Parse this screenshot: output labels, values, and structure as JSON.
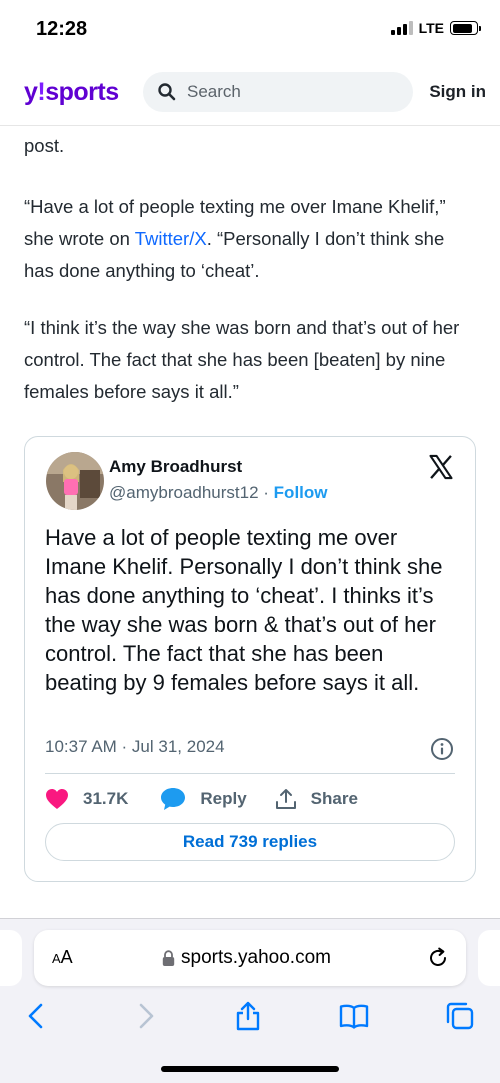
{
  "status_bar": {
    "time": "12:28",
    "network": "LTE",
    "battery_level": 0.85
  },
  "header": {
    "logo_y": "y",
    "logo_bang": "!",
    "logo_word": "sports",
    "search_placeholder": "Search",
    "signin_label": "Sign in"
  },
  "article": {
    "p0": "post.",
    "p1_a": "“Have a lot of people texting me over Imane Khelif,” she wrote on ",
    "p1_link": "Twitter/X",
    "p1_b": ". “Personally I don’t think she has done anything to ‘cheat’.",
    "p2": "“I think it’s the way she was born and that’s out of her control. The fact that she has been [beaten] by nine females before says it all.”"
  },
  "tweet": {
    "name": "Amy Broadhurst",
    "handle": "@amybroadhurst12",
    "separator": " · ",
    "follow_label": "Follow",
    "text": "Have a lot of people texting me over Imane Khelif. Personally I don’t think she has done anything to ‘cheat’. I thinks it’s the way she was born & that’s out of her control. The fact that she has been beating by 9 females before says it all.",
    "timestamp": "10:37 AM · Jul 31, 2024",
    "likes": "31.7K",
    "reply_label": "Reply",
    "share_label": "Share",
    "read_replies_label": "Read 739 replies"
  },
  "browser": {
    "text_size_label_small": "A",
    "text_size_label_large": "A",
    "url": "sports.yahoo.com"
  },
  "colors": {
    "brand": "#6001d2",
    "link": "#0f69ff",
    "twitter_blue": "#1d9bf0",
    "heart": "#f91880",
    "ios_blue": "#007aff"
  },
  "icons": [
    "search-icon",
    "x-logo-icon",
    "info-icon",
    "heart-icon",
    "reply-bubble-icon",
    "share-icon",
    "lock-icon",
    "reload-icon",
    "back-icon",
    "forward-icon",
    "share-sheet-icon",
    "bookmarks-icon",
    "tabs-icon"
  ]
}
